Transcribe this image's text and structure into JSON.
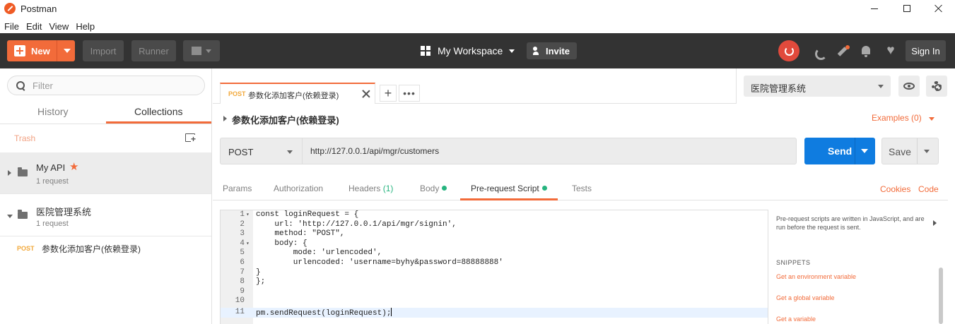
{
  "window": {
    "title": "Postman"
  },
  "menu": [
    "File",
    "Edit",
    "View",
    "Help"
  ],
  "header": {
    "new_label": "New",
    "import_label": "Import",
    "runner_label": "Runner",
    "workspace_label": "My Workspace",
    "invite_label": "Invite",
    "signin_label": "Sign In"
  },
  "sidebar": {
    "filter_placeholder": "Filter",
    "tabs": [
      "History",
      "Collections"
    ],
    "trash_label": "Trash",
    "collections": [
      {
        "name": "My API",
        "count": "1 request",
        "favorite": true
      },
      {
        "name": "医院管理系统",
        "count": "1 request",
        "favorite": false
      }
    ],
    "request": {
      "method": "POST",
      "name": "参数化添加客户(依赖登录)"
    }
  },
  "tab": {
    "method": "POST",
    "name": "参数化添加客户(依赖登录)"
  },
  "environment": {
    "selected": "医院管理系统"
  },
  "request": {
    "title": "参数化添加客户(依赖登录)",
    "examples_label": "Examples (0)",
    "method": "POST",
    "url": "http://127.0.0.1/api/mgr/customers",
    "send_label": "Send",
    "save_label": "Save"
  },
  "subtabs": {
    "params": "Params",
    "authorization": "Authorization",
    "headers": "Headers",
    "headers_count": "(1)",
    "body": "Body",
    "prerequest": "Pre-request Script",
    "tests": "Tests",
    "cookies": "Cookies",
    "code": "Code"
  },
  "editor": {
    "lines": [
      "const loginRequest = {",
      "    url: 'http://127.0.0.1/api/mgr/signin',",
      "    method: \"POST\",",
      "    body: {",
      "        mode: 'urlencoded',",
      "        urlencoded: 'username=byhy&password=88888888'",
      "}",
      "};",
      "",
      "",
      "pm.sendRequest(loginRequest);"
    ]
  },
  "snippets": {
    "description": "Pre-request scripts are written in JavaScript, and are run before the request is sent.",
    "title": "SNIPPETS",
    "items": [
      "Get an environment variable",
      "Get a global variable",
      "Get a variable"
    ]
  },
  "colors": {
    "accent": "#f26b3a",
    "header_bg": "#333333",
    "send_blue": "#0f7ce0",
    "status_green": "#26b47f"
  }
}
